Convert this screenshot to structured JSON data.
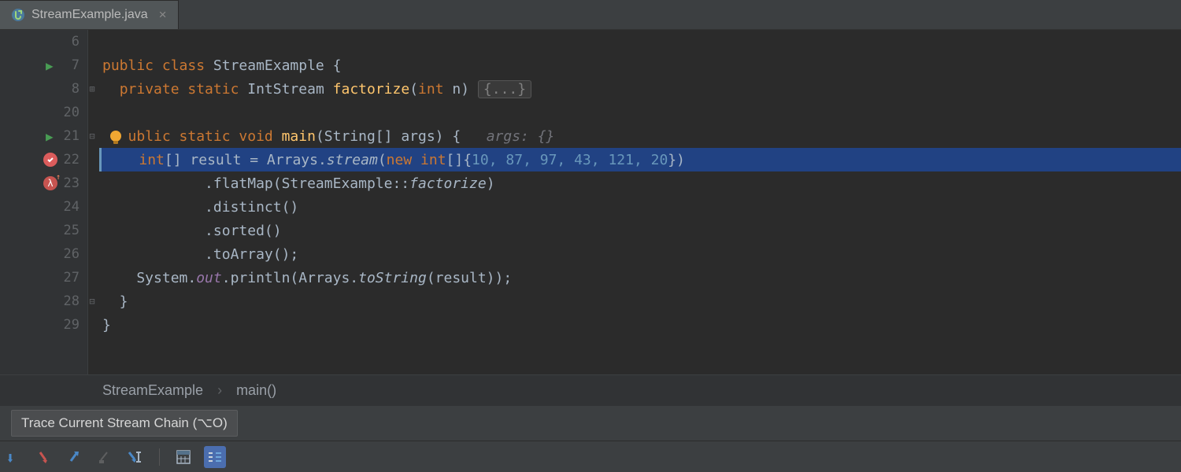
{
  "tab": {
    "filename": "StreamExample.java",
    "icon": "java-class-icon"
  },
  "gutter": {
    "lines": [
      "6",
      "7",
      "8",
      "20",
      "21",
      "22",
      "23",
      "24",
      "25",
      "26",
      "27",
      "28",
      "29"
    ]
  },
  "code": {
    "line7": {
      "kw1": "public class",
      "cls": "StreamExample",
      "brace": " {"
    },
    "line8": {
      "kw1": "private static",
      "type": "IntStream",
      "method": "factorize",
      "sig": "(",
      "kw2": "int",
      "arg": " n) ",
      "folded": "{...}"
    },
    "line21": {
      "kw1": "ublic static void",
      "method": "main",
      "sigL": "(String[] args) {",
      "hint": "   args: {}"
    },
    "line22": {
      "indent": "    ",
      "kw1": "int",
      "br": "[]",
      "var": " result = Arrays.",
      "m1": "stream",
      "p1": "(",
      "kw2": "new int",
      "p2": "[]{",
      "nums": "10, 87, 97, 43, 121, 20",
      "p3": "})"
    },
    "line23": {
      "indent": "            .",
      "m": "flatMap",
      "p1": "(StreamExample::",
      "m2": "factorize",
      "p2": ")"
    },
    "line24": {
      "indent": "            .",
      "m": "distinct",
      "p": "()"
    },
    "line25": {
      "indent": "            .",
      "m": "sorted",
      "p": "()"
    },
    "line26": {
      "indent": "            .",
      "m": "toArray",
      "p": "();"
    },
    "line27": {
      "pre": "    System.",
      "out": "out",
      "mid": ".println(Arrays.",
      "m": "toString",
      "post": "(result));"
    },
    "line28": {
      "t": "  }"
    },
    "line29": {
      "t": "}"
    }
  },
  "breadcrumbs": {
    "class": "StreamExample",
    "sep": "›",
    "method": "main()"
  },
  "tooltip": "Trace Current Stream Chain (⌥O)",
  "toolbar": {
    "buttons": [
      "step-out",
      "step-over",
      "force-step",
      "step-into",
      "step-into-my",
      "evaluate",
      "trace-stream"
    ]
  }
}
